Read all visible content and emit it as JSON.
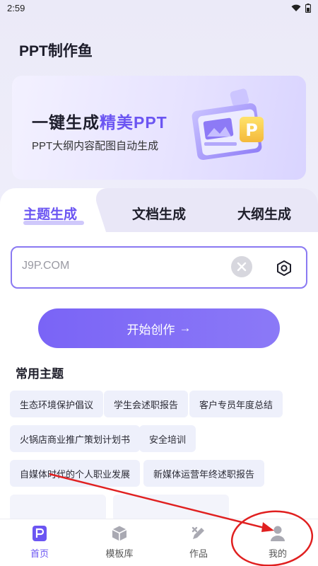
{
  "status": {
    "time": "2:59"
  },
  "app": {
    "title": "PPT制作鱼"
  },
  "banner": {
    "title_prefix": "一键生成",
    "title_accent": "精美PPT",
    "subtitle": "PPT大纲内容配图自动生成",
    "art_letter": "P"
  },
  "tabs": [
    {
      "label": "主题生成",
      "active": true
    },
    {
      "label": "文档生成",
      "active": false
    },
    {
      "label": "大纲生成",
      "active": false
    }
  ],
  "search": {
    "value": "J9P.COM"
  },
  "start_button": {
    "label": "开始创作",
    "arrow": "→"
  },
  "common_topics": {
    "title": "常用主题",
    "chips": [
      "生态环境保护倡议",
      "学生会述职报告",
      "客户专员年度总结",
      "火锅店商业推广策划计划书",
      "安全培训",
      "自媒体时代的个人职业发展",
      "新媒体运营年终述职报告"
    ]
  },
  "nav": [
    {
      "label": "首页",
      "icon": "home-icon",
      "active": true
    },
    {
      "label": "模板库",
      "icon": "cube-icon",
      "active": false
    },
    {
      "label": "作品",
      "icon": "works-icon",
      "active": false
    },
    {
      "label": "我的",
      "icon": "profile-icon",
      "active": false
    }
  ],
  "colors": {
    "accent": "#6b55f2",
    "annotation": "#e02020"
  }
}
